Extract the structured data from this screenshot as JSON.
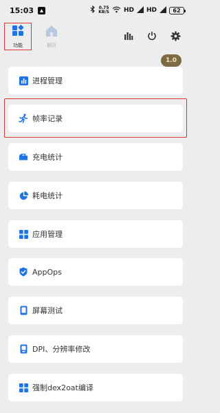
{
  "status_bar": {
    "time": "15:03",
    "net_speed_value": "0.75",
    "net_speed_unit": "KB/S",
    "network_1": "HD",
    "network_2": "HD",
    "battery": "62"
  },
  "tabs": [
    {
      "label": "功能",
      "icon": "grid-blocks-icon",
      "active": true
    },
    {
      "label": "期货",
      "icon": "home-icon",
      "active": false
    }
  ],
  "toolbar_icons": [
    "bar-chart-icon",
    "power-icon",
    "gear-icon"
  ],
  "version_badge": "1.0",
  "menu": [
    {
      "label": "进程管理",
      "icon": "process-chart-icon"
    },
    {
      "label": "帧率记录",
      "icon": "runner-icon"
    },
    {
      "label": "充电统计",
      "icon": "charger-icon"
    },
    {
      "label": "耗电统计",
      "icon": "pie-chart-icon"
    },
    {
      "label": "应用管理",
      "icon": "apps-grid-icon"
    },
    {
      "label": "AppOps",
      "icon": "shield-check-icon"
    },
    {
      "label": "屏幕测试",
      "icon": "phone-screen-icon"
    },
    {
      "label": "DPI、分辨率修改",
      "icon": "dpi-icon"
    },
    {
      "label": "强制dex2oat编译",
      "icon": "compile-grid-icon"
    }
  ],
  "colors": {
    "accent_blue": "#1e73e8",
    "highlight_red": "#d8343a",
    "badge_gold": "#7d6a42",
    "background": "#ededed"
  }
}
